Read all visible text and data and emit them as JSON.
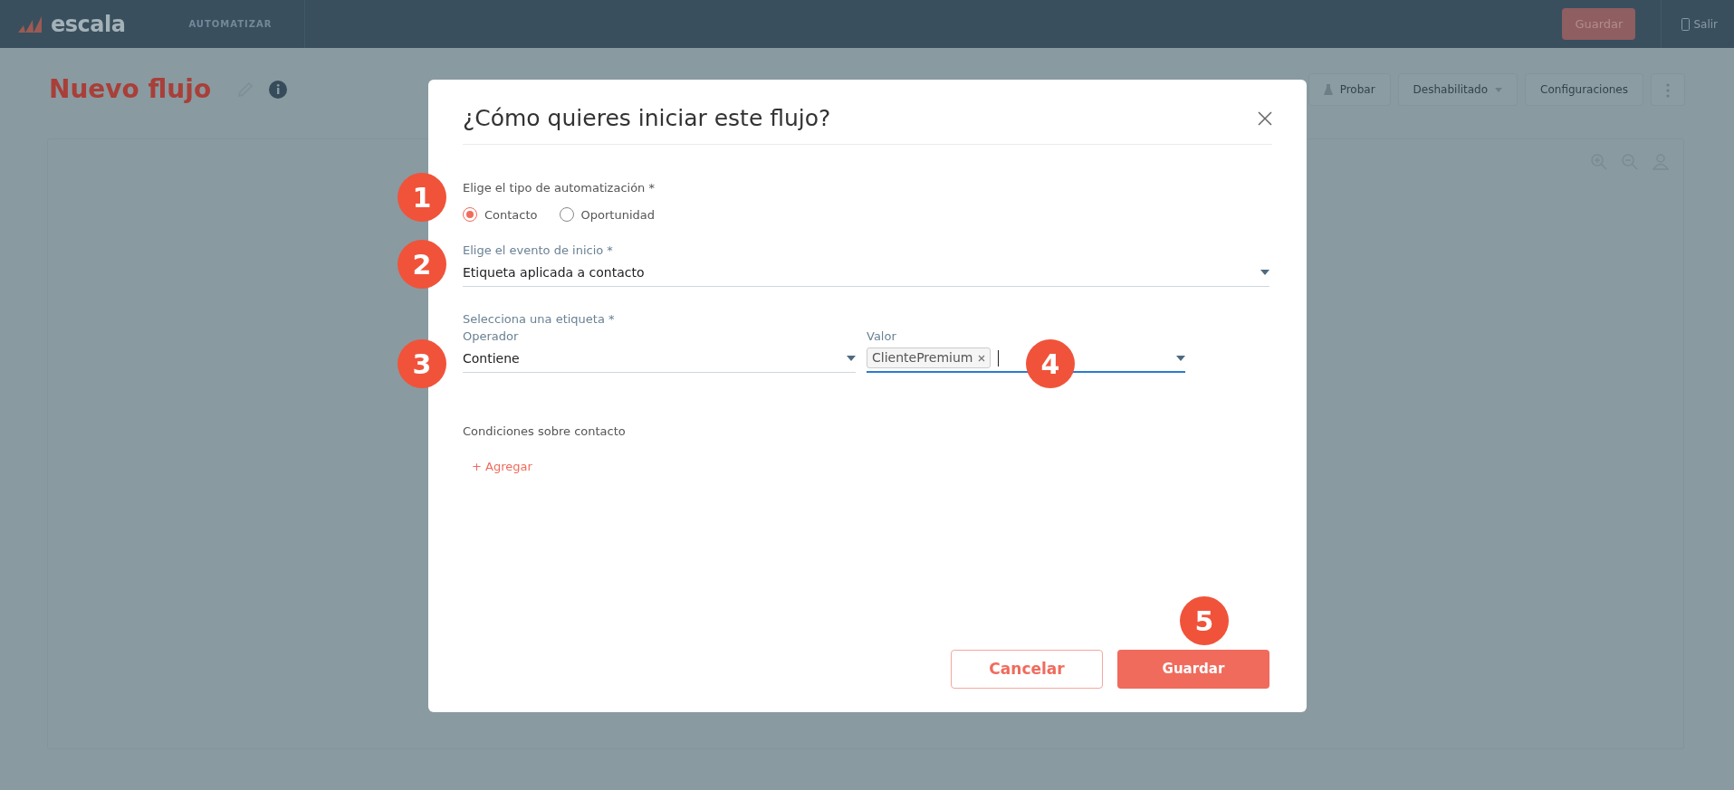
{
  "navbar": {
    "logo": "escala",
    "section": "AUTOMATIZAR",
    "save_button": "Guardar",
    "logout": "Salir"
  },
  "page": {
    "title": "Nuevo flujo",
    "toolbar": [
      {
        "label": "Probar",
        "kind": "icon"
      },
      {
        "label": "Deshabilitado",
        "kind": "dropdown"
      },
      {
        "label": "Configuraciones",
        "kind": "plain"
      }
    ]
  },
  "dialog": {
    "title": "¿Cómo quieres iniciar este flujo?",
    "automation_type": {
      "label": "Elige el tipo de automatización *",
      "options": [
        {
          "label": "Contacto",
          "selected": true
        },
        {
          "label": "Oportunidad",
          "selected": false
        }
      ]
    },
    "start_event": {
      "label": "Elige el evento de inicio *",
      "value": "Etiqueta aplicada a contacto"
    },
    "tag": {
      "label": "Selecciona una etiqueta *",
      "operator": {
        "label": "Operador",
        "value": "Contiene"
      },
      "value": {
        "label": "Valor",
        "chips": [
          "ClientePremium"
        ],
        "focused": true
      }
    },
    "conditions": {
      "label": "Condiciones sobre contacto",
      "add_link": "+ Agregar"
    },
    "buttons": [
      {
        "label": "Cancelar",
        "kind": "outline"
      },
      {
        "label": "Guardar",
        "kind": "primary"
      }
    ]
  },
  "markers": [
    "1",
    "2",
    "3",
    "4",
    "5"
  ]
}
